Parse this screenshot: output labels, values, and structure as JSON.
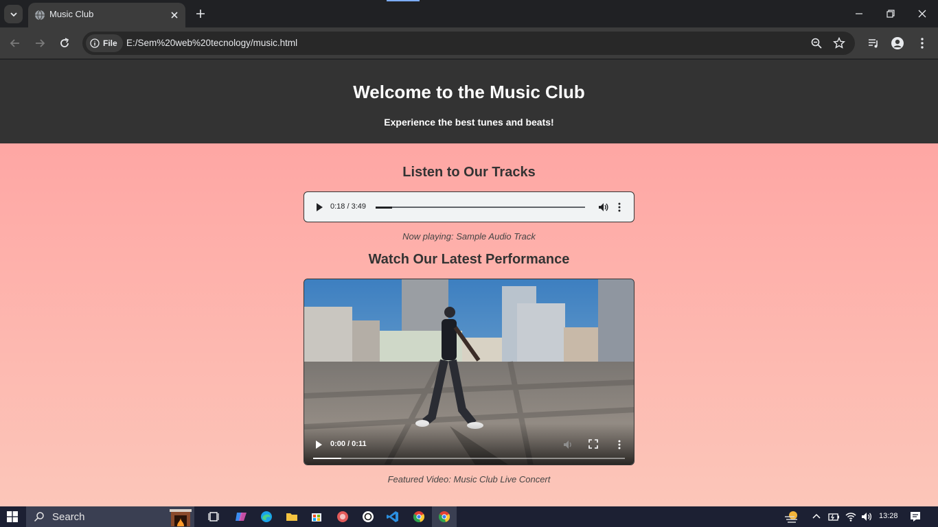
{
  "browser": {
    "tab_title": "Music Club",
    "chip_label": "File",
    "url": "E:/Sem%20web%20tecnology/music.html"
  },
  "page": {
    "title": "Welcome to the Music Club",
    "subtitle": "Experience the best tunes and beats!",
    "audio_section_title": "Listen to Our Tracks",
    "audio": {
      "time": "0:18 / 3:49",
      "progress_fraction": 0.08
    },
    "now_playing": "Now playing: Sample Audio Track",
    "video_section_title": "Watch Our Latest Performance",
    "video": {
      "time": "0:00 / 0:11",
      "progress_fraction": 0.09
    },
    "video_caption": "Featured Video: Music Club Live Concert"
  },
  "taskbar": {
    "search_placeholder": "Search",
    "clock": "13:28"
  },
  "icons": {
    "tab_search": "chevron-down-icon",
    "favicon": "globe-icon",
    "close": "close-icon",
    "new_tab": "plus-icon",
    "back": "arrow-left-icon",
    "forward": "arrow-right-icon",
    "reload": "reload-icon",
    "info": "info-icon",
    "zoom": "zoom-icon",
    "bookmark": "star-icon",
    "media": "media-control-icon",
    "profile": "profile-icon",
    "menu": "kebab-menu-icon"
  },
  "colors": {
    "header_bg": "#333333",
    "page_gradient_top": "#ff9f9f",
    "page_gradient_bottom": "#fcc6b9",
    "chrome_dark": "#202124",
    "chrome_toolbar": "#3c3c3c"
  }
}
